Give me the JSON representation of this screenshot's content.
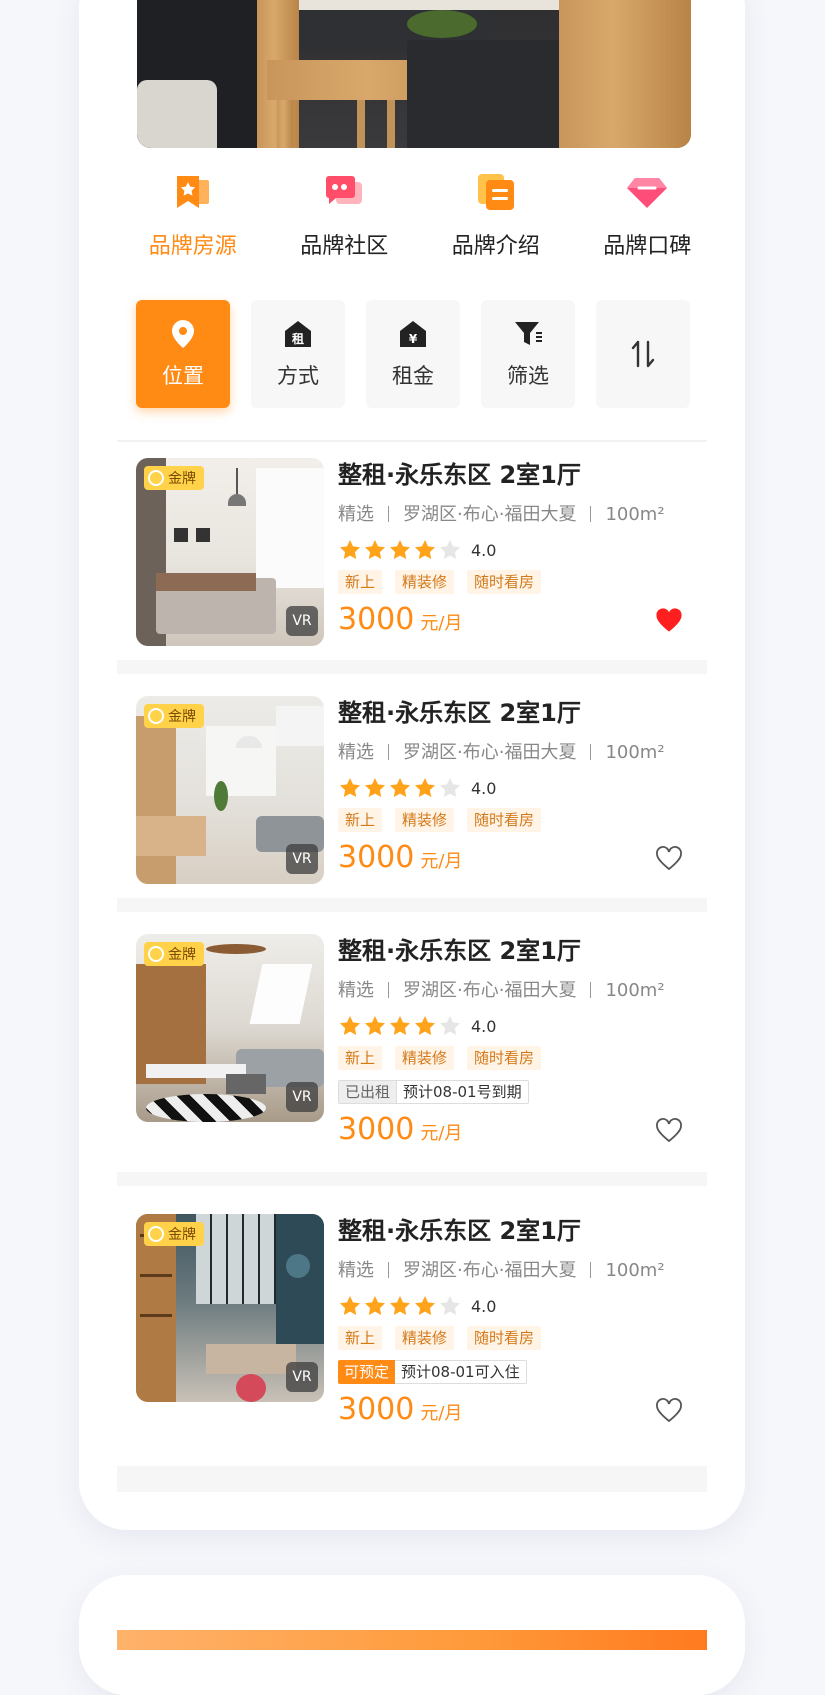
{
  "brand_nav": [
    {
      "label": "品牌房源",
      "icon": "bookmark-star-icon",
      "active": true
    },
    {
      "label": "品牌社区",
      "icon": "chat-bubble-icon",
      "active": false
    },
    {
      "label": "品牌介绍",
      "icon": "document-icon",
      "active": false
    },
    {
      "label": "品牌口碑",
      "icon": "gem-icon",
      "active": false
    }
  ],
  "filters": [
    {
      "label": "位置",
      "icon": "location-pin-icon",
      "active": true
    },
    {
      "label": "方式",
      "icon": "rent-house-icon",
      "glyph": "租",
      "active": false
    },
    {
      "label": "租金",
      "icon": "price-house-icon",
      "glyph": "¥",
      "active": false
    },
    {
      "label": "筛选",
      "icon": "filter-funnel-icon",
      "active": false
    },
    {
      "label": "⇅",
      "icon": "sort-icon",
      "active": false
    }
  ],
  "colors": {
    "accent": "#ff8a14",
    "heart_active": "#ff1f1f",
    "badge": "#ffd24a"
  },
  "listings": [
    {
      "badge": "金牌",
      "vr": "VR",
      "title": "整租·永乐东区 2室1厅",
      "type": "精选",
      "location": "罗湖区·布心·福田大夏",
      "area": "100m²",
      "rating": "4.0",
      "stars": 4,
      "tags": [
        "新上",
        "精装修",
        "随时看房"
      ],
      "price": "3000",
      "unit": "元/月",
      "favorited": true
    },
    {
      "badge": "金牌",
      "vr": "VR",
      "title": "整租·永乐东区 2室1厅",
      "type": "精选",
      "location": "罗湖区·布心·福田大夏",
      "area": "100m²",
      "rating": "4.0",
      "stars": 4,
      "tags": [
        "新上",
        "精装修",
        "随时看房"
      ],
      "price": "3000",
      "unit": "元/月",
      "favorited": false
    },
    {
      "badge": "金牌",
      "vr": "VR",
      "title": "整租·永乐东区 2室1厅",
      "type": "精选",
      "location": "罗湖区·布心·福田大夏",
      "area": "100m²",
      "rating": "4.0",
      "stars": 4,
      "tags": [
        "新上",
        "精装修",
        "随时看房"
      ],
      "status_label": "已出租",
      "status_text": "预计08-01号到期",
      "price": "3000",
      "unit": "元/月",
      "favorited": false
    },
    {
      "badge": "金牌",
      "vr": "VR",
      "title": "整租·永乐东区 2室1厅",
      "type": "精选",
      "location": "罗湖区·布心·福田大夏",
      "area": "100m²",
      "rating": "4.0",
      "stars": 4,
      "tags": [
        "新上",
        "精装修",
        "随时看房"
      ],
      "status_label": "可预定",
      "status_text": "预计08-01可入住",
      "price": "3000",
      "unit": "元/月",
      "favorited": false
    }
  ]
}
